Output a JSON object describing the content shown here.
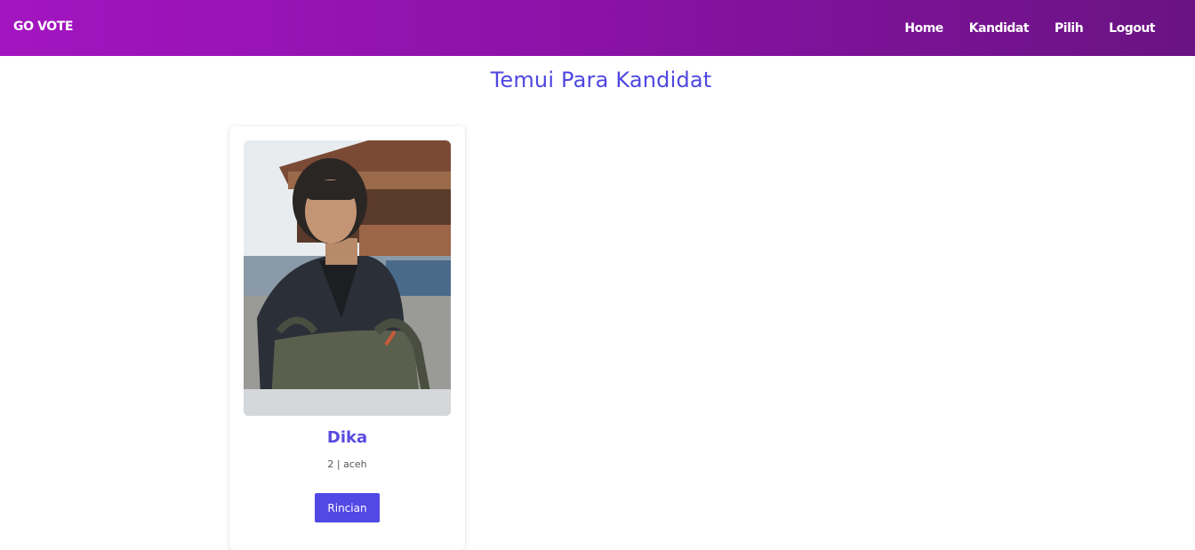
{
  "navbar": {
    "brand": "GO VOTE",
    "links": [
      "Home",
      "Kandidat",
      "Pilih",
      "Logout"
    ]
  },
  "page": {
    "title": "Temui Para Kandidat"
  },
  "candidates": [
    {
      "name": "Dika",
      "meta": "2 | aceh",
      "button_label": "Rincian"
    }
  ],
  "colors": {
    "navbar_start": "#a315c0",
    "navbar_end": "#6a1383",
    "accent": "#5148e5",
    "title": "#4f47e0"
  }
}
